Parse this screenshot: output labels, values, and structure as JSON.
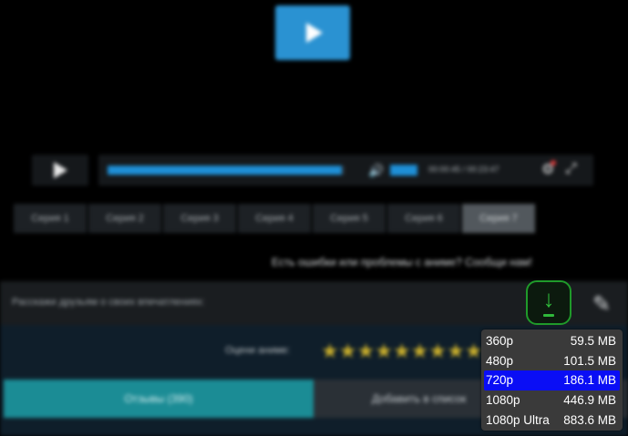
{
  "player": {
    "big_play_icon": "play-icon",
    "controls": {
      "play_icon": "play-icon",
      "progress_fraction": 0.99,
      "volume_icon": "volume-icon",
      "time": "00:00:45 / 00:23:47",
      "settings_icon": "gear-icon",
      "fullscreen_icon": "fullscreen-icon"
    }
  },
  "episodes": [
    {
      "label": "Серия 1"
    },
    {
      "label": "Серия 2"
    },
    {
      "label": "Серия 3"
    },
    {
      "label": "Серия 4"
    },
    {
      "label": "Серия 5"
    },
    {
      "label": "Серия 6"
    },
    {
      "label": "Серия 7",
      "active": true
    }
  ],
  "error_message": "Есть ошибки или проблемы с аниме? Сообщи нам!",
  "share": {
    "text": "Расскажи друзьям о своих впечатлениях:"
  },
  "download": {
    "icon": "download-icon",
    "accent": "#1f9a2a",
    "qualities": [
      {
        "label": "360p",
        "size": "59.5 MB"
      },
      {
        "label": "480p",
        "size": "101.5 MB"
      },
      {
        "label": "720p",
        "size": "186.1 MB",
        "selected": true
      },
      {
        "label": "1080p",
        "size": "446.9 MB"
      },
      {
        "label": "1080p Ultra",
        "size": "883.6 MB"
      }
    ]
  },
  "rating": {
    "label": "Оцени аниме:",
    "stars": 10
  },
  "actions": {
    "reviews_label": "Отзывы (390)",
    "add_label": "Добавить в список"
  },
  "colors": {
    "accent_blue": "#2a92d2",
    "teal": "#1b8c95",
    "selected": "#0a0ef5",
    "star": "#c9ae2c"
  }
}
